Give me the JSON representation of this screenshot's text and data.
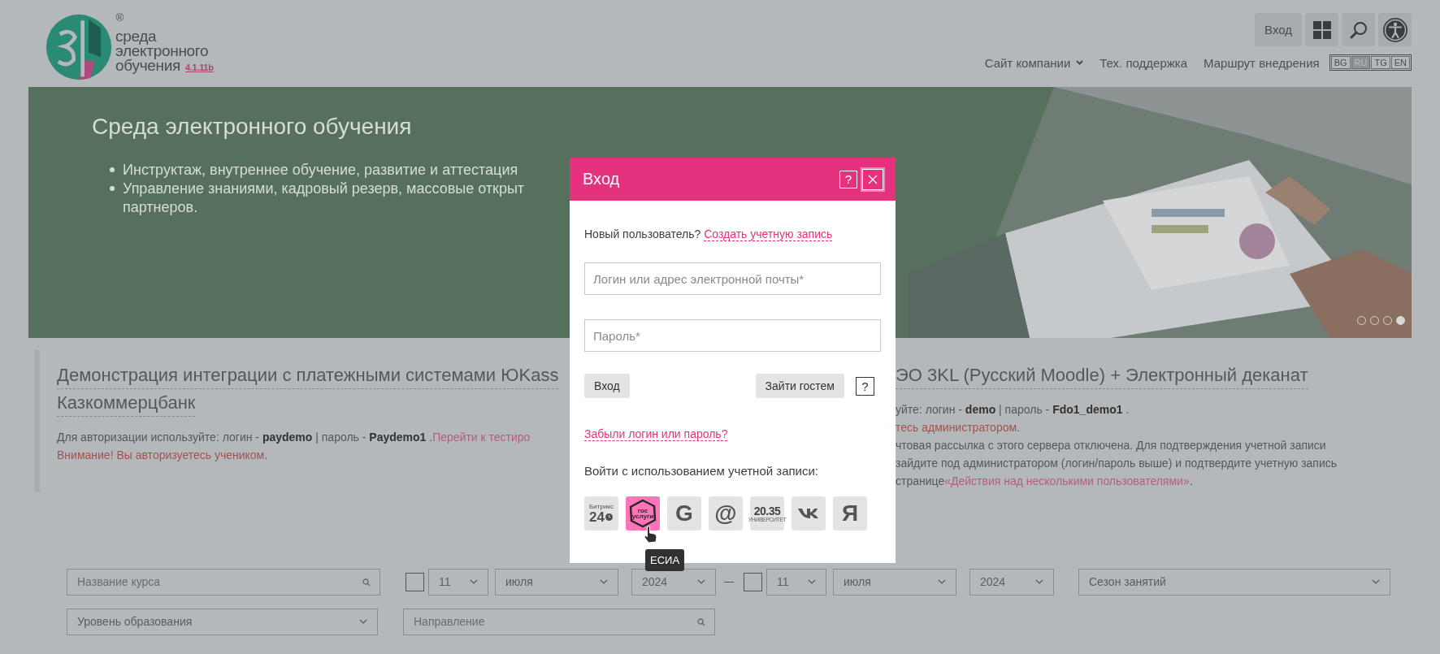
{
  "header": {
    "logo": {
      "lines": [
        "среда",
        "электронного",
        "обучения"
      ],
      "version": "4.1.11b",
      "registered": "®"
    },
    "login_button": "Вход",
    "nav": [
      {
        "label": "Сайт компании",
        "dropdown": true
      },
      {
        "label": "Тех. поддержка",
        "dropdown": false
      },
      {
        "label": "Маршрут внедрения",
        "dropdown": false
      }
    ],
    "languages": [
      {
        "label": "BG",
        "selected": false
      },
      {
        "label": "RU",
        "selected": true
      },
      {
        "label": "TG",
        "selected": false
      },
      {
        "label": "EN",
        "selected": false
      }
    ]
  },
  "hero": {
    "title": "Среда электронного обучения",
    "bullets": [
      {
        "lines": [
          "Инструктаж, внутреннее обучение, развитие и аттестация"
        ]
      },
      {
        "lines": [
          "Управление знаниями, кадровый резерв, массовые открыт",
          "партнеров."
        ]
      }
    ],
    "slides": [
      {
        "selected": false
      },
      {
        "selected": false
      },
      {
        "selected": false
      },
      {
        "selected": true
      }
    ]
  },
  "demos": [
    {
      "title_lines": [
        "Демонстрация интеграции с платежными системами ЮKass",
        "Казкоммерцбанк"
      ],
      "lines": [
        {
          "kind": "text",
          "text": "Для авторизации используйте: логин - **paydemo** | пароль - **Paydemo1** .",
          "link": "Перейти к тестиро"
        },
        {
          "kind": "warn",
          "text": "Внимание! Вы авторизуетесь учеником",
          "after": "."
        }
      ]
    },
    {
      "title_lines": [
        "ЭО 3KL (Русский Moodle) + Электронный деканат"
      ],
      "lines": [
        {
          "kind": "text",
          "text": "уйте: логин - **demo** | пароль - **Fdo1_demo1** ."
        },
        {
          "kind": "warn",
          "text": "тесь администратором",
          "after": "."
        },
        {
          "kind": "text",
          "text": "чтовая рассылка с этого сервера отключена. Для подтверждения учетной записи"
        },
        {
          "kind": "text",
          "text": " зайдите под администратором (логин/пароль выше) и подтвердите учетную запись"
        },
        {
          "kind": "text",
          "text": " странице",
          "link": "«Действия над несколькими пользователями»",
          "after": "."
        }
      ]
    }
  ],
  "filters": {
    "course": {
      "placeholder": "Название курса"
    },
    "date_from": {
      "checked": false,
      "day": "11",
      "month": "июля",
      "year": "2024"
    },
    "date_to": {
      "checked": false,
      "day": "11",
      "month": "июля",
      "year": "2024"
    },
    "season": "Сезон занятий",
    "level": "Уровень образования",
    "direction": {
      "placeholder": "Направление"
    }
  },
  "modal": {
    "title": "Вход",
    "help": "?",
    "new_user": "Новый пользователь?",
    "create_link": "Создать учетную запись",
    "login": {
      "placeholder": "Логин или адрес электронной почты*"
    },
    "password": {
      "placeholder": "Пароль*"
    },
    "submit": "Вход",
    "guest": "Зайти гостем",
    "guest_help": "?",
    "forgot": "Забыли логин или пароль?",
    "social_label": "Войти с использованием учетной записи:",
    "providers": [
      {
        "kind": "bitrix",
        "label": "Битрикс",
        "sub": "24",
        "selected": false
      },
      {
        "kind": "gosuslugi",
        "label": "гос",
        "sub": "услуги",
        "selected": true,
        "tooltip": "ЕСИА"
      },
      {
        "kind": "letter",
        "label": "G",
        "selected": false
      },
      {
        "kind": "letter",
        "label": "@",
        "selected": false
      },
      {
        "kind": "univ",
        "label": "20.35",
        "sub": "УНИВЕРСИТЕТ",
        "selected": false
      },
      {
        "kind": "vk",
        "selected": false
      },
      {
        "kind": "letter",
        "label": "Я",
        "selected": false
      }
    ]
  }
}
